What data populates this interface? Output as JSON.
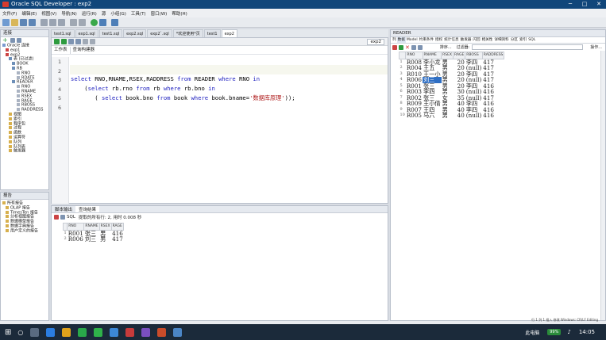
{
  "window": {
    "title": "Oracle SQL Developer : exp2"
  },
  "menu": [
    "文件(F)",
    "编辑(E)",
    "视图(V)",
    "导航(N)",
    "运行(R)",
    "源",
    "小组(G)",
    "工具(T)",
    "窗口(W)",
    "帮助(H)"
  ],
  "connections": {
    "title": "连接",
    "tree": [
      "Oracle 连接",
      "exp1",
      "exp2",
      "表 (已过滤)",
      "BOOK",
      "RB",
      "RNO",
      "RDATE",
      "READER",
      "RNO",
      "RNAME",
      "RSEX",
      "RAGE",
      "RBOSS",
      "RADDRESS",
      "视图",
      "索引",
      "程序包",
      "过程",
      "函数",
      "运算符",
      "队列",
      "队列表",
      "触发器"
    ]
  },
  "reports": {
    "title": "报告",
    "items": [
      "所有报告",
      "OLAP 报告",
      "TimesTen 报告",
      "分析视图报告",
      "数据模型报告",
      "数据字典报告",
      "用户定义的报告"
    ]
  },
  "editor_tabs": [
    "test1.sql",
    "exp1.sql",
    "test1.sql",
    "exp2.sql",
    "exp2`.sql",
    "*欢迎使用*页",
    "test1",
    "exp2"
  ],
  "editor": {
    "connection": "exp2",
    "subtabs": [
      "工作表",
      "查询构建器"
    ],
    "line_numbers": [
      "1",
      "2",
      "3",
      "4",
      "5",
      "6"
    ]
  },
  "results": {
    "tabs": [
      "脚本输出",
      "查询结果"
    ],
    "status": "提取的所有行: 2, 用时 0.008 秒",
    "sql_label": "SQL",
    "columns": [
      "RNO",
      "RNAME",
      "RSEX",
      "RAGE"
    ],
    "rows": [
      [
        "1",
        "R001",
        "张三",
        "男",
        "416"
      ],
      [
        "2",
        "R006",
        "刘三",
        "男",
        "417"
      ]
    ]
  },
  "reader": {
    "title": "READER",
    "tabs": [
      "列",
      "数据",
      "Model",
      "约束条件",
      "授权",
      "统计信息",
      "触发器",
      "闪回",
      "相关性",
      "详细资料",
      "分区",
      "索引",
      "SQL"
    ],
    "sort_label": "排序...",
    "filter_label": "过滤器:",
    "action_label": "操作...",
    "columns": [
      "RNO",
      "RNAME",
      "RSEX",
      "RAGE",
      "RBOSS",
      "RADDRESS"
    ],
    "rows": [
      [
        "1",
        "R008",
        "李小龙",
        "男",
        "20",
        "李四",
        "417"
      ],
      [
        "2",
        "R004",
        "王五",
        "男",
        "20",
        "(null)",
        "417"
      ],
      [
        "3",
        "R010",
        "王一小",
        "男",
        "20",
        "李四",
        "417"
      ],
      [
        "4",
        "R006",
        "刘三",
        "男",
        "20",
        "(null)",
        "417"
      ],
      [
        "5",
        "R001",
        "张三",
        "男",
        "20",
        "李四",
        "416"
      ],
      [
        "6",
        "R003",
        "李四",
        "男",
        "30",
        "(null)",
        "416"
      ],
      [
        "7",
        "R002",
        "张三",
        "女",
        "35",
        "(null)",
        "417"
      ],
      [
        "8",
        "R009",
        "王小倩",
        "男",
        "40",
        "李四",
        "416"
      ],
      [
        "9",
        "R007",
        "王四",
        "男",
        "40",
        "李四",
        "416"
      ],
      [
        "10",
        "R005",
        "马六",
        "男",
        "40",
        "(null)",
        "416"
      ]
    ]
  },
  "statusbar": {
    "text": "行 1 列 1  插入  修改  Windows: CR/LF  Editing"
  },
  "taskbar": {
    "time": "14:05",
    "battery": "99%",
    "label": "此电脑"
  }
}
